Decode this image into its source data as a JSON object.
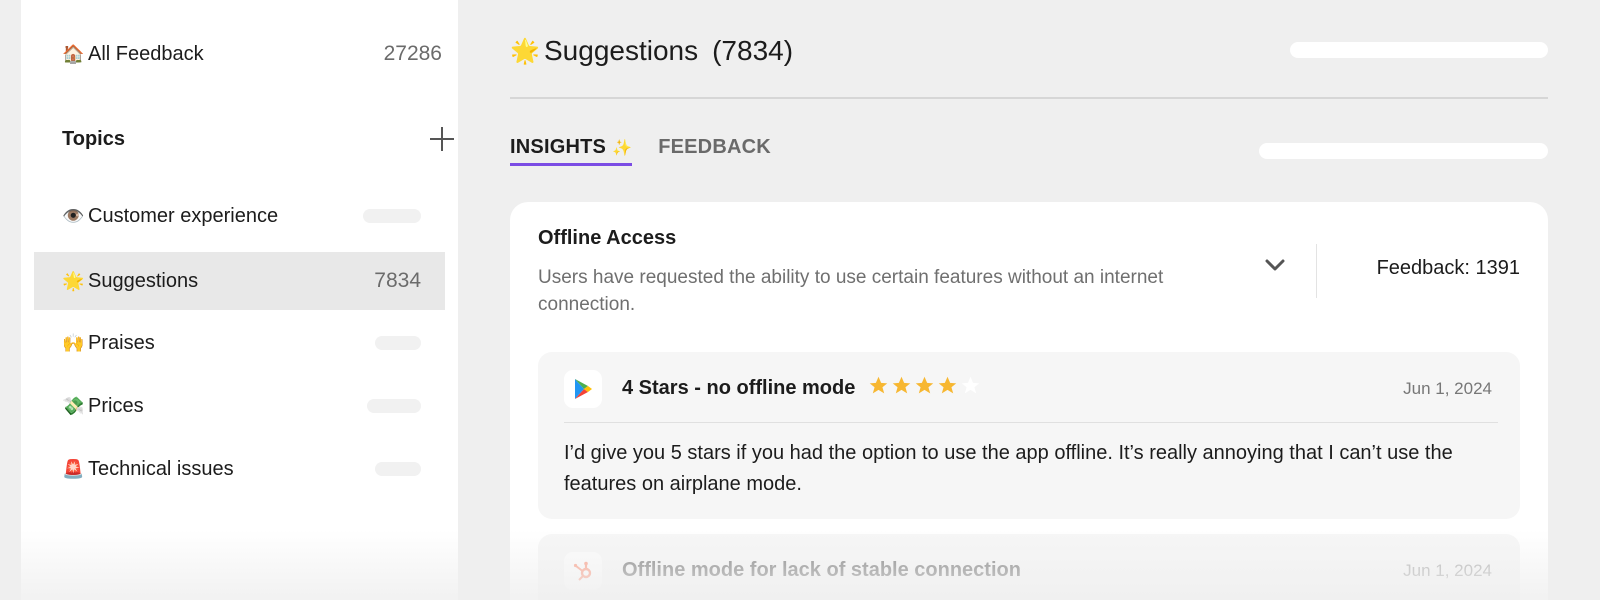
{
  "sidebar": {
    "all_feedback": {
      "icon": "house-emoji",
      "glyph": "🏠",
      "label": "All Feedback",
      "count": "27286"
    },
    "topics_title": "Topics",
    "add_icon": "plus-icon",
    "topics": [
      {
        "icon": "eye-emoji",
        "glyph": "👁️",
        "label": "Customer experience",
        "count": null
      },
      {
        "icon": "glowing-star-emoji",
        "glyph": "🌟",
        "label": "Suggestions",
        "count": "7834",
        "active": true
      },
      {
        "icon": "raising-hands-emoji",
        "glyph": "🙌",
        "label": "Praises",
        "count": null
      },
      {
        "icon": "money-wings-emoji",
        "glyph": "💸",
        "label": "Prices",
        "count": null
      },
      {
        "icon": "siren-emoji",
        "glyph": "🚨",
        "label": "Technical issues",
        "count": null
      }
    ]
  },
  "header": {
    "icon": "glowing-star-emoji",
    "glyph": "🌟",
    "title": "Suggestions",
    "count": "(7834)"
  },
  "tabs": [
    {
      "label": "INSIGHTS",
      "icon": "sparkle-icon",
      "glyph": "✨",
      "active": true
    },
    {
      "label": "FEEDBACK",
      "active": false
    }
  ],
  "insight": {
    "title": "Offline Access",
    "description": "Users have requested the ability to use certain features without an internet connection.",
    "feedback_label": "Feedback: 1391",
    "reviews": [
      {
        "source_icon": "google-play-icon",
        "title": "4 Stars - no offline mode",
        "rating": 4,
        "max_rating": 5,
        "date": "Jun 1, 2024",
        "body": "I’d give you 5 stars if you had the option to use the app offline. It’s really annoying that I can’t use the features on airplane mode."
      },
      {
        "source_icon": "hubspot-icon",
        "title": "Offline mode for lack of stable connection",
        "date": "Jun 1, 2024"
      }
    ]
  },
  "colors": {
    "accent": "#7b4ce4",
    "star": "#f7b731",
    "active_row": "#e8e8e8",
    "hubspot": "#ff7a59"
  }
}
